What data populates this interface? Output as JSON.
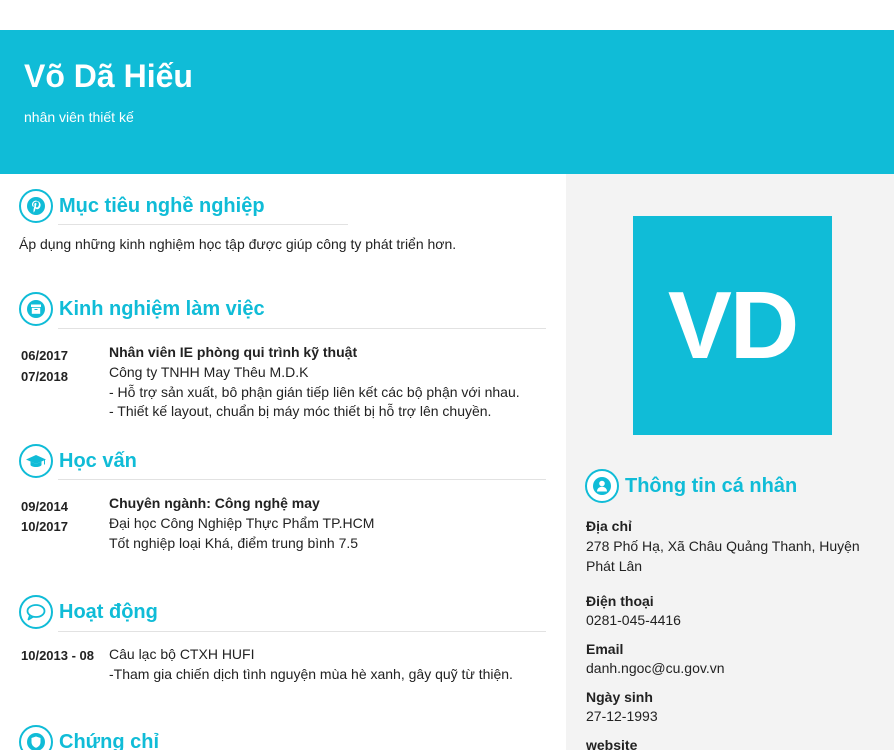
{
  "header": {
    "name": "Võ Dã Hiếu",
    "role": "nhân viên thiết kế"
  },
  "avatar": {
    "initials": "VD"
  },
  "sections": {
    "objective": {
      "title": "Mục tiêu nghề nghiệp",
      "icon": "pinterest-icon",
      "text": "Áp dụng những kinh nghiệm học tập được giúp công ty phát triển hơn."
    },
    "experience": {
      "title": "Kinh nghiệm làm việc",
      "icon": "archive-box-icon",
      "items": [
        {
          "start": "06/2017",
          "end": "07/2018",
          "position": "Nhân viên IE phòng  qui trình kỹ thuật",
          "company": "Công ty TNHH May Thêu M.D.K",
          "details": [
            "- Hỗ trợ sản xuất, bô phận gián tiếp liên kết các bộ phận với nhau.",
            "- Thiết kế layout, chuẩn bị máy móc thiết bị hỗ trợ lên chuyền."
          ]
        }
      ]
    },
    "education": {
      "title": "Học vấn",
      "icon": "graduation-cap-icon",
      "items": [
        {
          "start": "09/2014",
          "end": "10/2017",
          "major": "Chuyên ngành: Công nghệ may",
          "school": "Đại học  Công Nghiệp Thực Phẩm TP.HCM",
          "result": "Tốt nghiệp loại Khá, điểm trung bình 7.5"
        }
      ]
    },
    "activities": {
      "title": "Hoạt động",
      "icon": "speech-bubble-icon",
      "items": [
        {
          "date": "10/2013  - 08",
          "org": "Câu lạc  bộ CTXH HUFI",
          "detail": "-Tham gia chiến dịch tình nguyện mùa hè xanh, gây quỹ từ thiện."
        }
      ]
    },
    "certificates": {
      "title": "Chứng chỉ",
      "icon": "shield-icon"
    }
  },
  "personal": {
    "title": "Thông tin cá nhân",
    "icon": "user-icon",
    "address_label": "Địa chỉ",
    "address_line1": "278 Phố Hạ, Xã Châu Quảng Thanh, Huyện",
    "address_line2": "Phát Lân",
    "phone_label": "Điện thoại",
    "phone": "0281-045-4416",
    "email_label": "Email",
    "email": "danh.ngoc@cu.gov.vn",
    "dob_label": "Ngày sinh",
    "dob": "27-12-1993",
    "website_label": "website"
  },
  "colors": {
    "accent": "#10bcd7",
    "panel": "#f3f3f3"
  }
}
